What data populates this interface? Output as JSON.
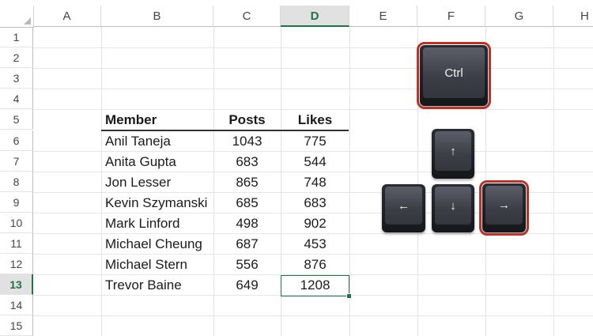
{
  "columns": [
    "A",
    "B",
    "C",
    "D",
    "E",
    "F",
    "G",
    "H"
  ],
  "active_column": "D",
  "rows": [
    "1",
    "2",
    "3",
    "4",
    "5",
    "6",
    "7",
    "8",
    "9",
    "10",
    "11",
    "12",
    "13",
    "14",
    "15"
  ],
  "active_row": "13",
  "table": {
    "headers": [
      "Member",
      "Posts",
      "Likes"
    ],
    "rows": [
      [
        "Anil Taneja",
        "1043",
        "775"
      ],
      [
        "Anita Gupta",
        "683",
        "544"
      ],
      [
        "Jon Lesser",
        "865",
        "748"
      ],
      [
        "Kevin Szymanski",
        "685",
        "683"
      ],
      [
        "Mark Linford",
        "498",
        "902"
      ],
      [
        "Michael Cheung",
        "687",
        "453"
      ],
      [
        "Michael Stern",
        "556",
        "876"
      ],
      [
        "Trevor Baine",
        "649",
        "1208"
      ]
    ]
  },
  "keys": {
    "ctrl": "Ctrl",
    "up": "↑",
    "left": "←",
    "down": "↓",
    "right": "→"
  },
  "colors": {
    "accent": "#217346",
    "key_highlight": "#b5342b"
  }
}
